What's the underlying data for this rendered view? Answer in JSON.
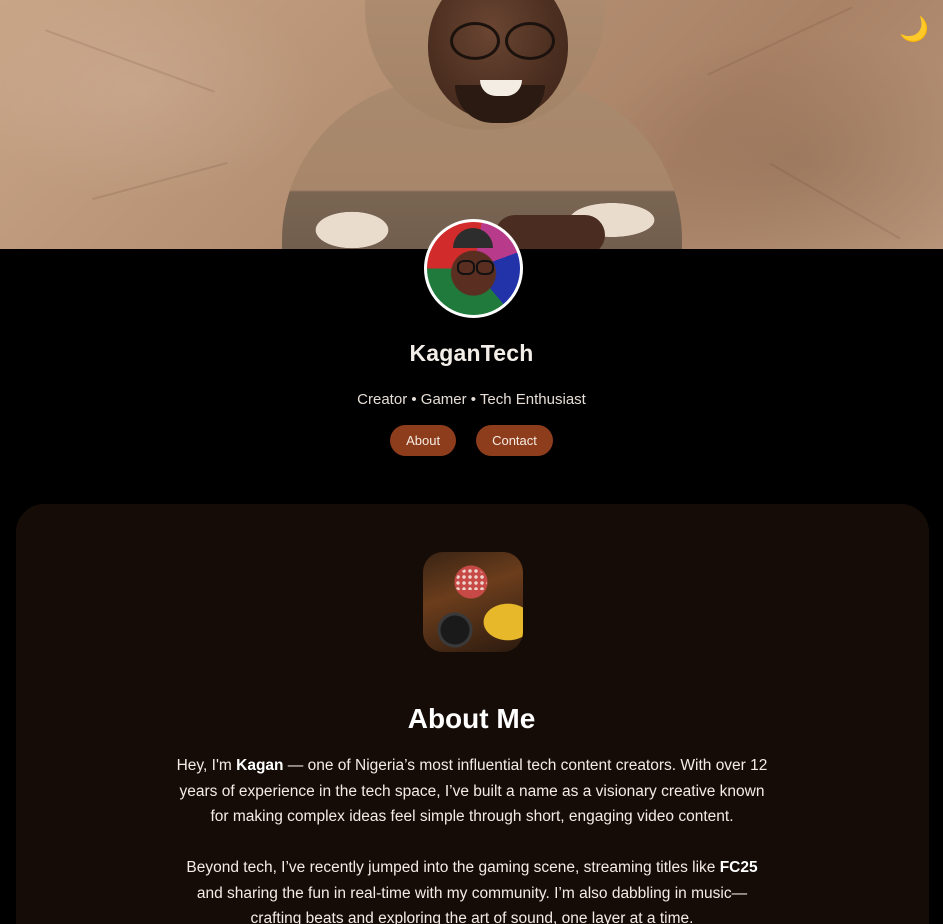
{
  "theme_toggle": {
    "icon": "moon-icon",
    "glyph": "🌙"
  },
  "profile": {
    "name": "KaganTech",
    "tagline": "Creator • Gamer • Tech Enthusiast"
  },
  "nav": {
    "about_label": "About",
    "contact_label": "Contact"
  },
  "about": {
    "title": "About Me",
    "p1_lead": "Hey, I'm ",
    "p1_name": "Kagan",
    "p1_rest": " — one of Nigeria’s most influential tech content creators. With over 12 years of experience in the tech space, I’ve built a name as a visionary creative known for making complex ideas feel simple through short, engaging video content.",
    "p2_lead": "Beyond tech, I’ve recently jumped into the gaming scene, streaming titles like ",
    "p2_game": "FC25",
    "p2_rest": " and sharing the fun in real-time with my community. I’m also dabbling in music—crafting beats and exploring the art of sound, one layer at a time."
  },
  "colors": {
    "accent": "#8e3d1c",
    "page_bg": "#000000",
    "card_bg": "#150c07",
    "moon": "#f3b73c"
  }
}
